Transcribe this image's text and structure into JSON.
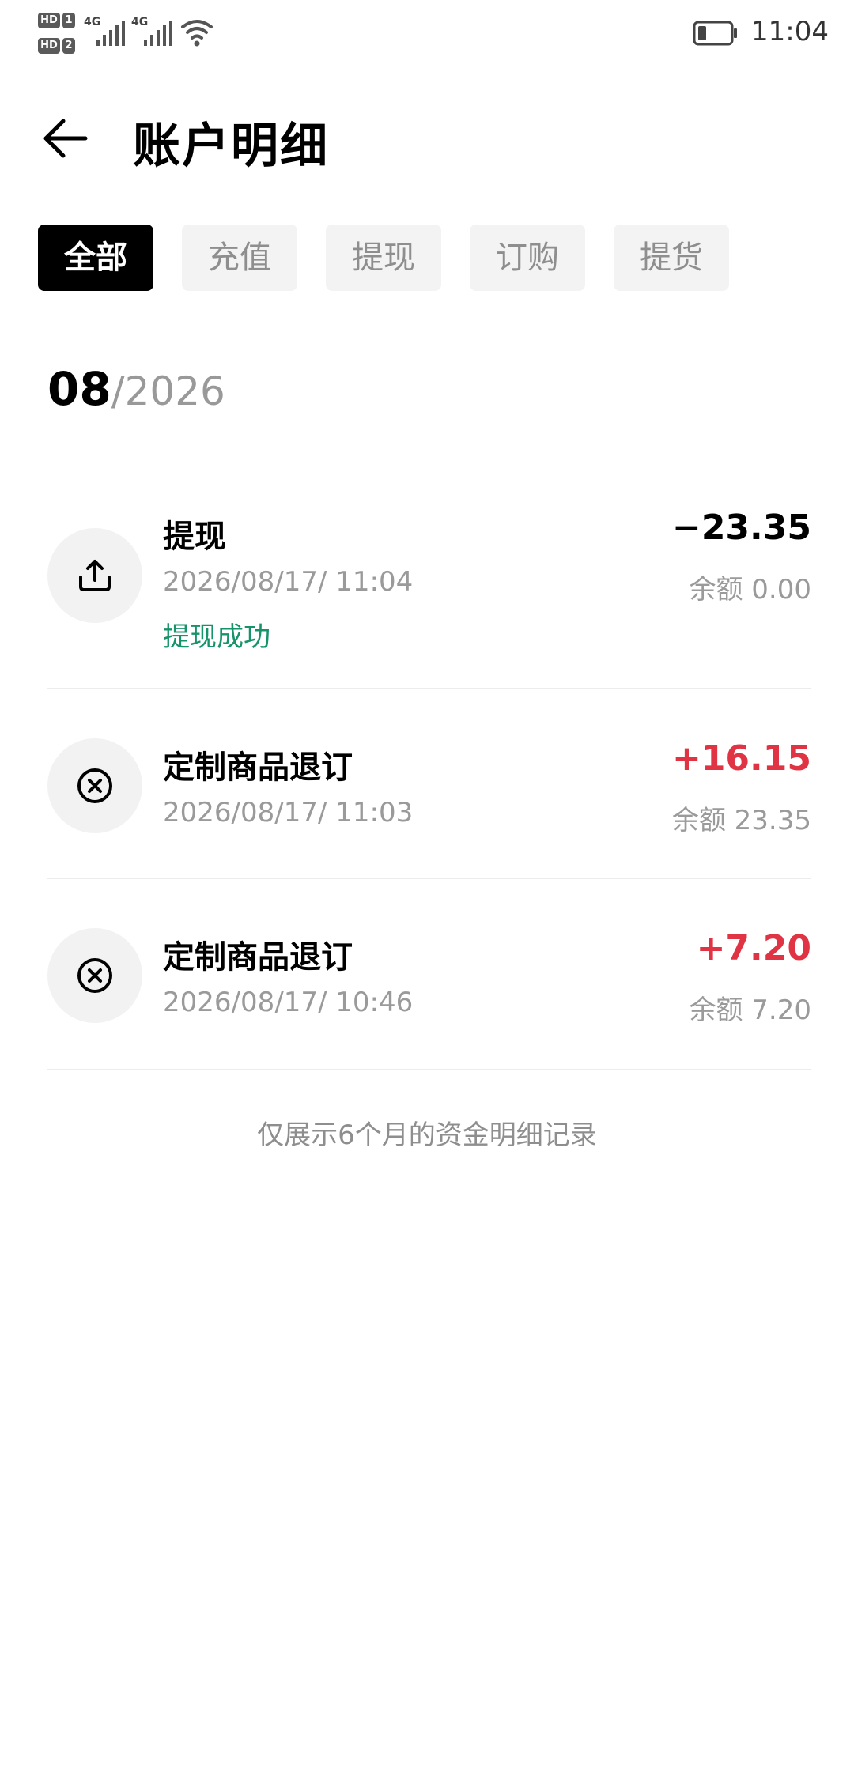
{
  "status_bar": {
    "sim1": {
      "hd": "HD",
      "slot": "1",
      "network": "4G"
    },
    "sim2": {
      "hd": "HD",
      "slot": "2",
      "network": "4G"
    },
    "time": "11:04",
    "battery_level": 0.25
  },
  "header": {
    "back_icon": "back-arrow-icon",
    "title": "账户明细"
  },
  "tabs": [
    {
      "label": "全部",
      "active": true
    },
    {
      "label": "充值",
      "active": false
    },
    {
      "label": "提现",
      "active": false
    },
    {
      "label": "订购",
      "active": false
    },
    {
      "label": "提货",
      "active": false
    }
  ],
  "month_header": {
    "month": "08",
    "year": "/2026"
  },
  "transactions": [
    {
      "icon": "upload-icon",
      "title": "提现",
      "time": "2026/08/17/ 11:04",
      "status": "提现成功",
      "amount": "−23.35",
      "balance": "余额 0.00"
    },
    {
      "icon": "cancel-circle-icon",
      "title": "定制商品退订",
      "time": "2026/08/17/ 11:03",
      "amount": "+16.15",
      "balance": "余额 23.35"
    },
    {
      "icon": "cancel-circle-icon",
      "title": "定制商品退订",
      "time": "2026/08/17/ 10:46",
      "amount": "+7.20",
      "balance": "余额 7.20"
    }
  ],
  "footer_note": "仅展示6个月的资金明细记录",
  "colors": {
    "positive_amount": "#e03444",
    "status_success": "#17936a",
    "tab_active_bg": "#000000",
    "tab_inactive_bg": "#f3f3f3"
  }
}
